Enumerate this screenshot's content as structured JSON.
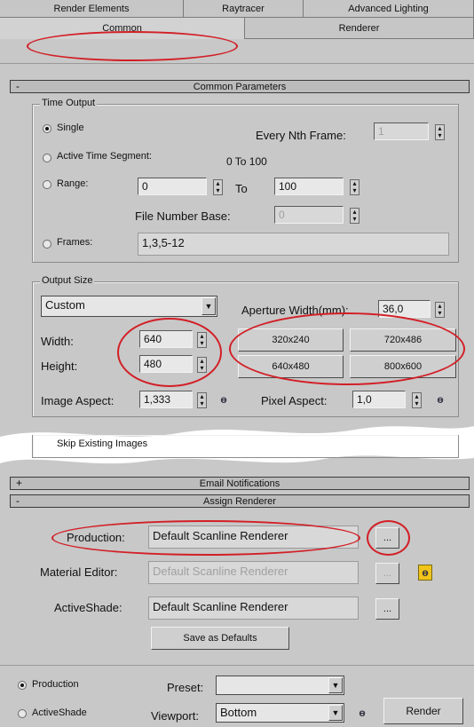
{
  "tabs_row1": [
    "Render Elements",
    "Raytracer",
    "Advanced Lighting"
  ],
  "tabs_row2": [
    "Common",
    "Renderer"
  ],
  "common_parameters": {
    "header": "Common Parameters",
    "collapse_symbol": "-",
    "time_output": {
      "title": "Time Output",
      "single": "Single",
      "every_nth_label": "Every Nth Frame:",
      "every_nth_value": "1",
      "active_segment_label": "Active Time Segment:",
      "active_segment_value": "0 To 100",
      "range_label": "Range:",
      "range_from": "0",
      "range_to_label": "To",
      "range_to": "100",
      "file_number_base_label": "File Number Base:",
      "file_number_base_value": "0",
      "frames_label": "Frames:",
      "frames_value": "1,3,5-12",
      "selected": "Single"
    },
    "output_size": {
      "title": "Output Size",
      "preset": "Custom",
      "aperture_label": "Aperture Width(mm):",
      "aperture_value": "36,0",
      "width_label": "Width:",
      "width_value": "640",
      "height_label": "Height:",
      "height_value": "480",
      "presets": [
        "320x240",
        "720x486",
        "640x480",
        "800x600"
      ],
      "image_aspect_label": "Image Aspect:",
      "image_aspect_value": "1,333",
      "pixel_aspect_label": "Pixel Aspect:",
      "pixel_aspect_value": "1,0"
    },
    "skip_existing": "Skip Existing Images"
  },
  "email_notifications": {
    "header": "Email Notifications",
    "expand_symbol": "+"
  },
  "assign_renderer": {
    "header": "Assign Renderer",
    "collapse_symbol": "-",
    "production_label": "Production:",
    "production_value": "Default Scanline Renderer",
    "material_editor_label": "Material Editor:",
    "material_editor_value": "Default Scanline Renderer",
    "activeshade_label": "ActiveShade:",
    "activeshade_value": "Default Scanline Renderer",
    "browse_label": "...",
    "save_defaults": "Save as Defaults"
  },
  "bottom": {
    "production": "Production",
    "activeshade": "ActiveShade",
    "selected": "Production",
    "preset_label": "Preset:",
    "preset_value": "",
    "viewport_label": "Viewport:",
    "viewport_value": "Bottom",
    "render": "Render"
  },
  "colors": {
    "highlight": "#d21f26",
    "lock_yellow": "#f0c419"
  }
}
